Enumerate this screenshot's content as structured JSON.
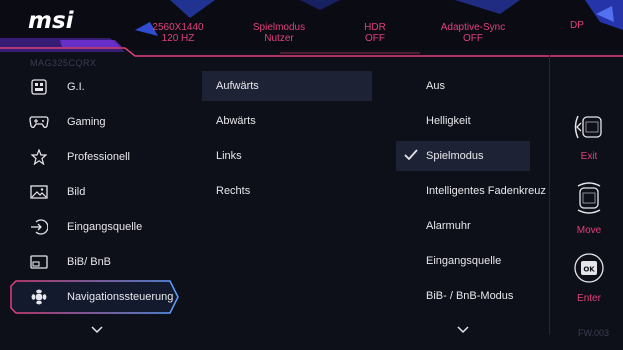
{
  "brand": "msi",
  "status_bar": [
    {
      "line1": "2560X1440",
      "line2": "120 HZ"
    },
    {
      "line1": "Spielmodus",
      "line2": "Nutzer"
    },
    {
      "line1": "HDR",
      "line2": "OFF"
    },
    {
      "line1": "Adaptive-Sync",
      "line2": "OFF"
    },
    {
      "line1": "DP",
      "line2": ""
    }
  ],
  "model": "MAG325CQRX",
  "firmware": "FW.003",
  "main_menu": [
    {
      "label": "G.I.",
      "icon": "gi-icon"
    },
    {
      "label": "Gaming",
      "icon": "gamepad-icon"
    },
    {
      "label": "Professionell",
      "icon": "star-icon"
    },
    {
      "label": "Bild",
      "icon": "image-icon"
    },
    {
      "label": "Eingangsquelle",
      "icon": "input-source-icon"
    },
    {
      "label": "BiB/ BnB",
      "icon": "pip-icon"
    },
    {
      "label": "Navigationssteuerung",
      "icon": "navigation-icon"
    }
  ],
  "direction_menu": [
    "Aufwärts",
    "Abwärts",
    "Links",
    "Rechts"
  ],
  "function_menu": [
    "Aus",
    "Helligkeit",
    "Spielmodus",
    "Intelligentes Fadenkreuz",
    "Alarmuhr",
    "Eingangsquelle",
    "BiB- / BnB-Modus"
  ],
  "controls": {
    "exit": "Exit",
    "move": "Move",
    "enter": "Enter"
  },
  "colors": {
    "accent": "#e0407a",
    "highlight_border": "#4a7bff",
    "selected_bg": "#1e2235"
  }
}
